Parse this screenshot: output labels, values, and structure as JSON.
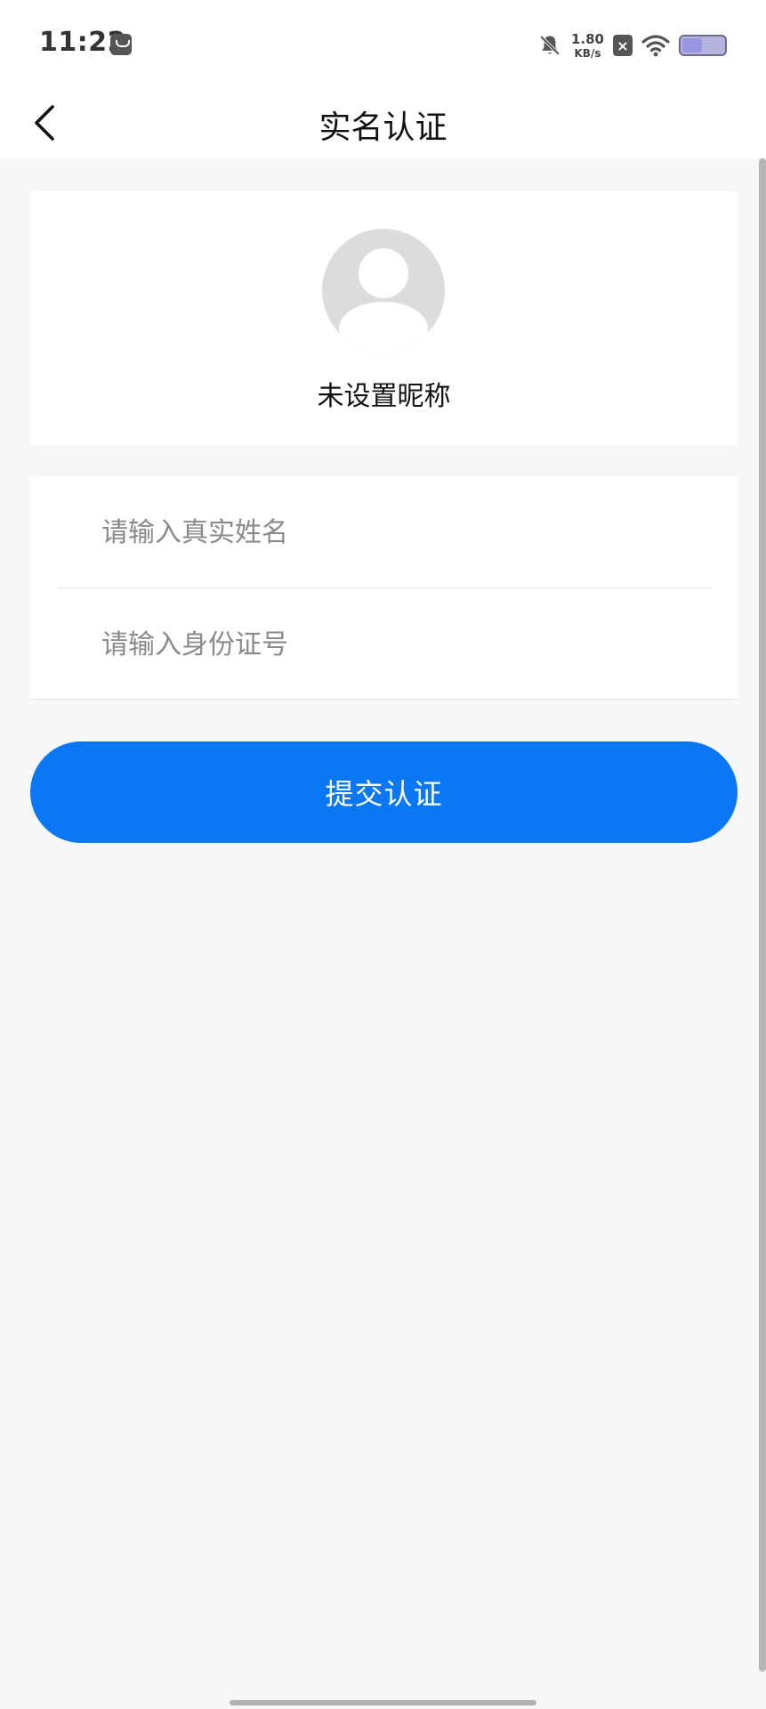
{
  "status_bar": {
    "time": "11:22",
    "net_speed_value": "1.80",
    "net_speed_unit": "KB/s",
    "sim_badge": "×",
    "icons": [
      "app-notification-icon",
      "bell-off-icon",
      "sim-x-icon",
      "wifi-icon",
      "battery-icon"
    ]
  },
  "nav": {
    "title": "实名认证",
    "back_icon": "chevron-left-icon"
  },
  "profile": {
    "nickname": "未设置昵称",
    "avatar_icon": "default-avatar-icon"
  },
  "form": {
    "name_placeholder": "请输入真实姓名",
    "id_placeholder": "请输入身份证号"
  },
  "submit": {
    "label": "提交认证"
  },
  "colors": {
    "accent": "#0a78f5",
    "background": "#f6f7f9",
    "card": "#ffffff",
    "placeholder": "#8a8a8a"
  }
}
